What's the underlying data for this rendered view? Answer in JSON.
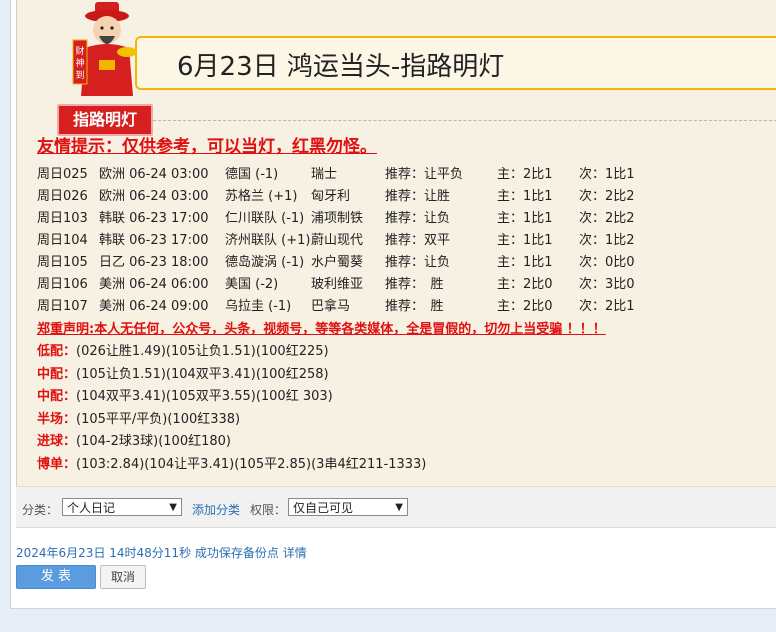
{
  "header": {
    "title": "6月23日 鸿运当头-指路明灯",
    "badge": "指路明灯",
    "mascot_sign": "财神到"
  },
  "tip": "友情提示：仅供参考，可以当灯，红黑勿怪。",
  "matches": [
    {
      "id": "周日025",
      "league_time": "欧洲 06-24 03:00",
      "home": "德国 (-1)",
      "away": "瑞士",
      "rec": "推荐：让平负",
      "main": "主：2比1",
      "sub": "次：1比1"
    },
    {
      "id": "周日026",
      "league_time": "欧洲 06-24 03:00",
      "home": "苏格兰 (+1)",
      "away": "匈牙利",
      "rec": "推荐：让胜",
      "main": "主：1比1",
      "sub": "次：2比2"
    },
    {
      "id": "周日103",
      "league_time": "韩联 06-23 17:00",
      "home": "仁川联队 (-1)",
      "away": "浦项制铁",
      "rec": "推荐：让负",
      "main": "主：1比1",
      "sub": "次：2比2"
    },
    {
      "id": "周日104",
      "league_time": "韩联 06-23 17:00",
      "home": "济州联队 (+1)",
      "away": "蔚山现代",
      "rec": "推荐：双平",
      "main": "主：1比1",
      "sub": "次：1比2"
    },
    {
      "id": "周日105",
      "league_time": "日乙 06-23 18:00",
      "home": "德岛漩涡 (-1)",
      "away": "水户蜀葵",
      "rec": "推荐：让负",
      "main": "主：1比1",
      "sub": "次：0比0"
    },
    {
      "id": "周日106",
      "league_time": "美洲 06-24 06:00",
      "home": "美国 (-2)",
      "away": "玻利维亚",
      "rec": "推荐：　胜",
      "main": "主：2比0",
      "sub": "次：3比0"
    },
    {
      "id": "周日107",
      "league_time": "美洲 06-24 09:00",
      "home": "乌拉圭 (-1)",
      "away": "巴拿马",
      "rec": "推荐：　胜",
      "main": "主：2比0",
      "sub": "次：2比1"
    }
  ],
  "notice": "郑重声明:本人无任何，公众号，头条，视频号，等等各类媒体，全是冒假的，切勿上当受骗 ！！！",
  "picks": [
    {
      "label": "低配：",
      "text": "(026让胜1.49)(105让负1.51)(100红225)"
    },
    {
      "label": "中配：",
      "text": "(105让负1.51)(104双平3.41)(100红258)"
    },
    {
      "label": "中配：",
      "text": "(104双平3.41)(105双平3.55)(100红 303)"
    },
    {
      "label": "半场：",
      "text": "(105平平/平负)(100红338)"
    },
    {
      "label": "进球：",
      "text": "(104-2球3球)(100红180)"
    },
    {
      "label": "博单：",
      "text": "(103:2.84)(104让平3.41)(105平2.85)(3串4红211-1333)"
    }
  ],
  "category_bar": {
    "category_label": "分类：",
    "category_value": "个人日记",
    "add_category": "添加分类",
    "permission_label": "权限：",
    "permission_value": "仅自己可见"
  },
  "status": "2024年6月23日 14时48分11秒 成功保存备份点 详情",
  "buttons": {
    "publish": "发 表",
    "cancel": "取消"
  }
}
